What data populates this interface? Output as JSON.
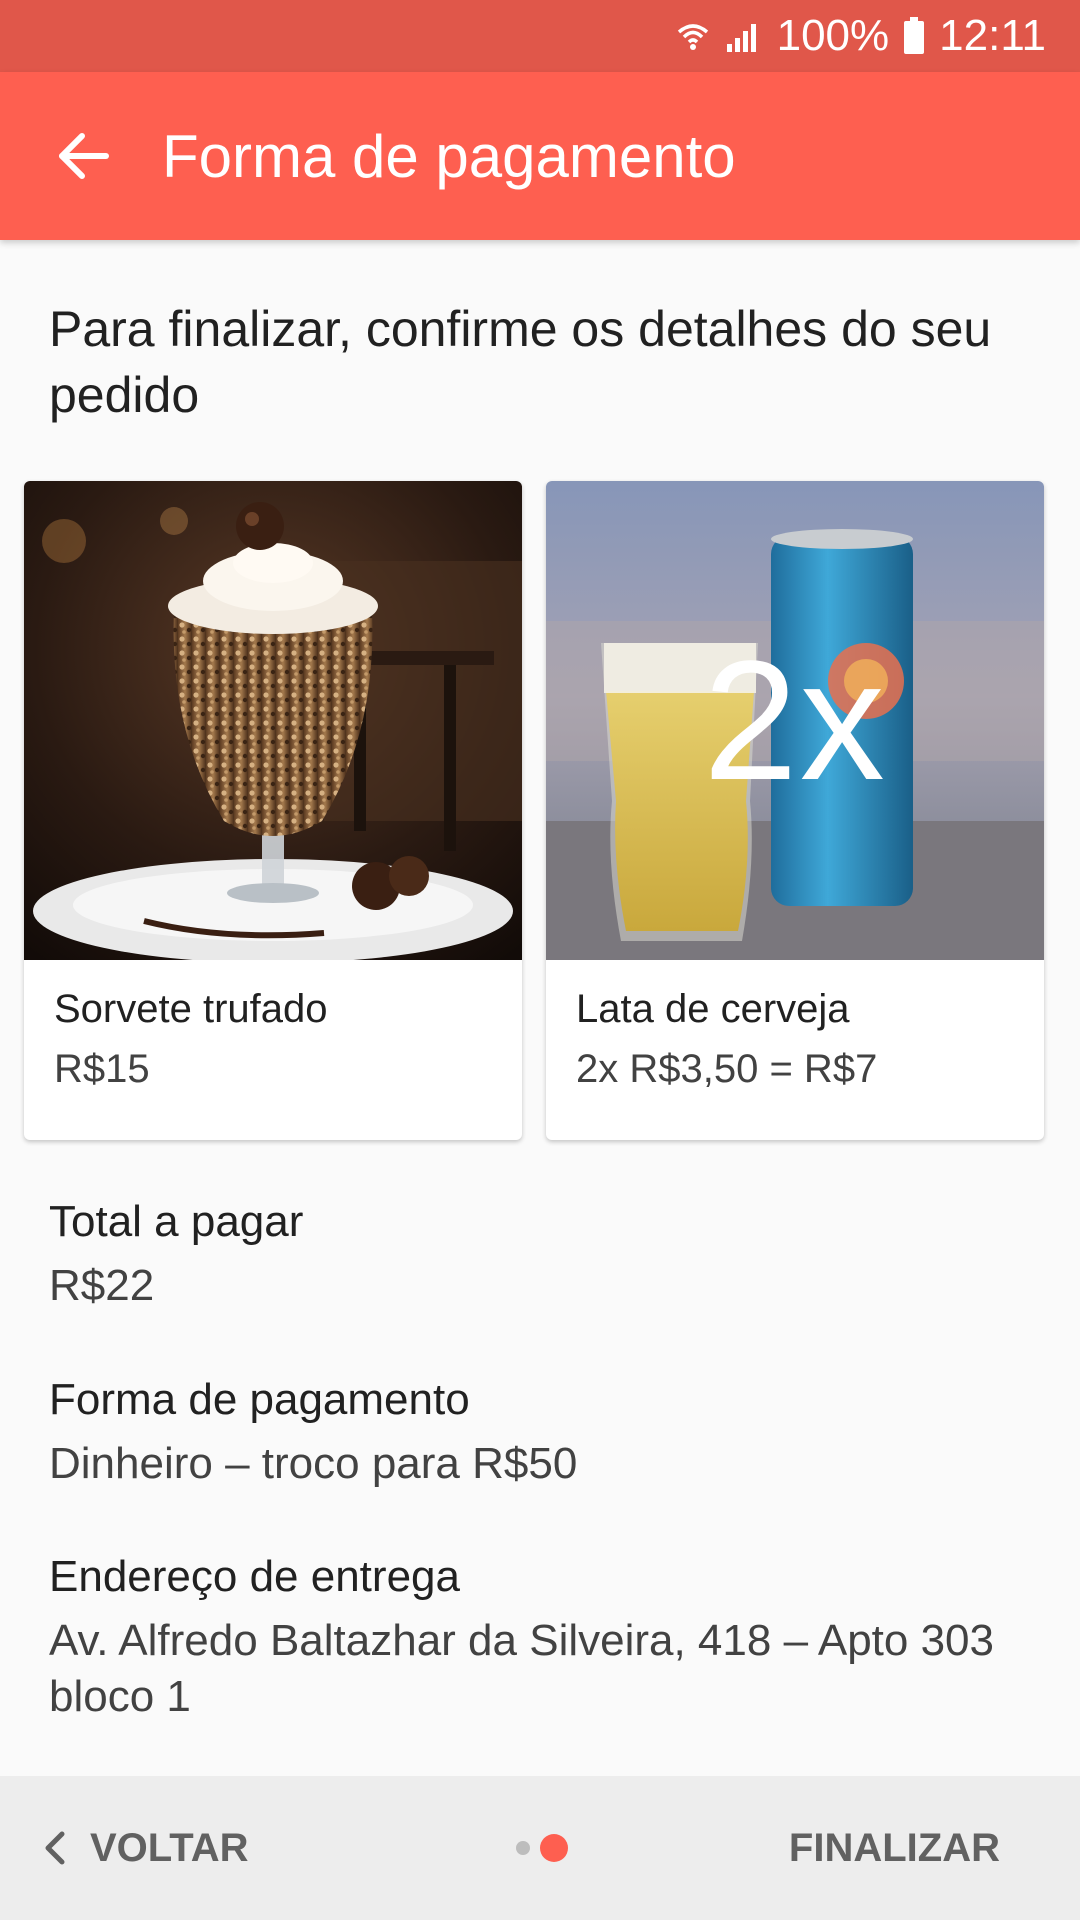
{
  "status_bar": {
    "battery": "100%",
    "time": "12:11"
  },
  "app_bar": {
    "title": "Forma de pagamento"
  },
  "intro_text": "Para finalizar, confirme os detalhes do seu pedido",
  "items": [
    {
      "name": "Sorvete trufado",
      "price": "R$15",
      "image_icon": "ice-cream-sundae-photo"
    },
    {
      "name": "Lata de cerveja",
      "price": "2x R$3,50 = R$7",
      "quantity_badge": "2x",
      "image_icon": "beer-can-photo"
    }
  ],
  "summary": {
    "total_label": "Total a pagar",
    "total_value": "R$22",
    "payment_label": "Forma de pagamento",
    "payment_value": "Dinheiro – troco para R$50",
    "address_label": "Endereço de entrega",
    "address_value": "Av. Alfredo Baltazhar da Silveira, 418 – Apto 303 bloco 1"
  },
  "bottom_bar": {
    "back_label": "VOLTAR",
    "finish_label": "FINALIZAR",
    "pager": {
      "current": 2,
      "total": 2
    }
  },
  "colors": {
    "status_bar": "#e0574a",
    "app_bar": "#fe5f50",
    "accent": "#fe5f50",
    "background": "#fafafa",
    "bottom_bar": "#ededed"
  }
}
